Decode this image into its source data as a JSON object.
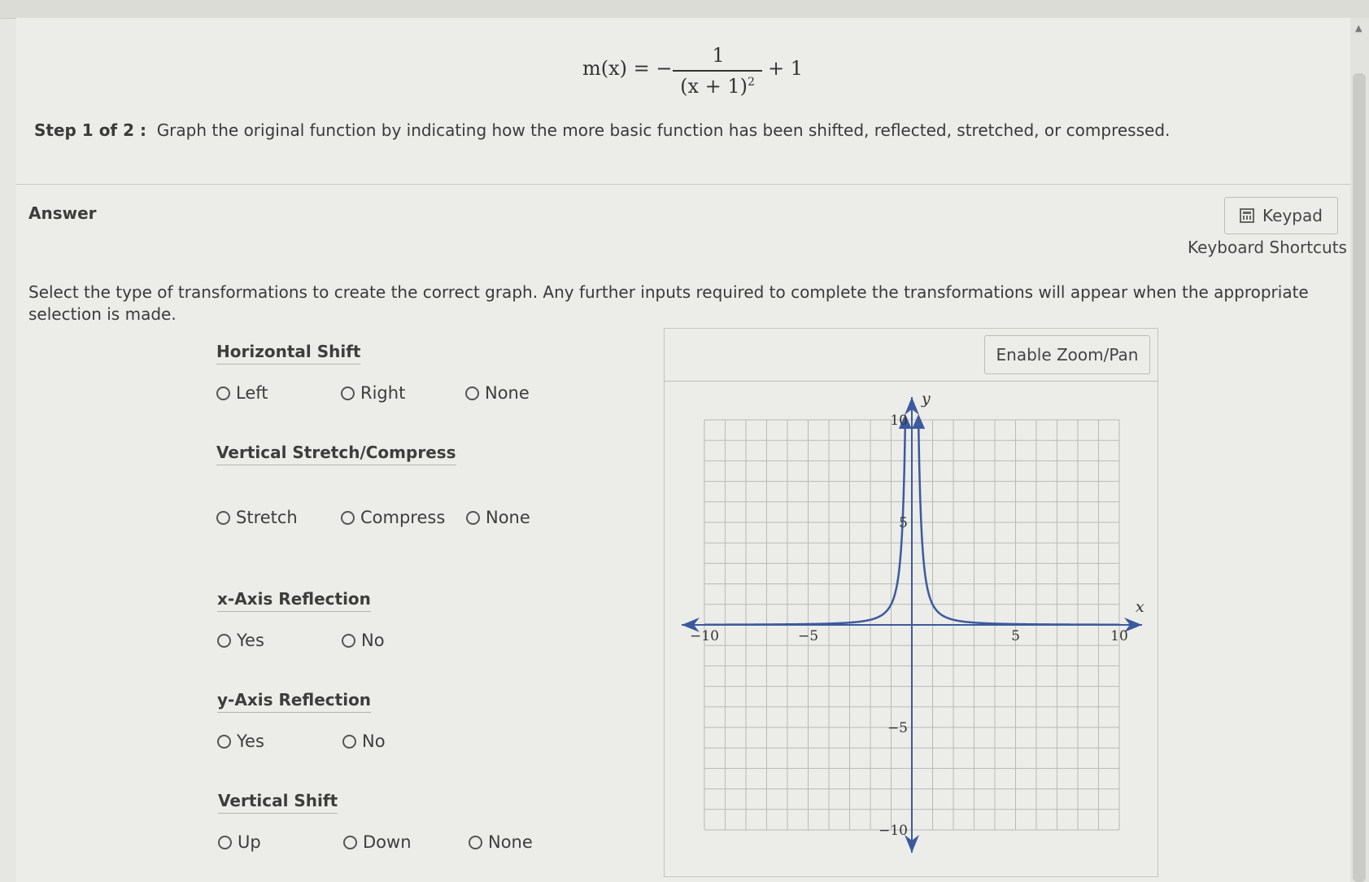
{
  "problem": {
    "formula": {
      "lhs": "m(x) = −",
      "numerator": "1",
      "denominator": "(x + 1)",
      "exponent": "2",
      "rhs": "+ 1"
    },
    "step_label": "Step 1 of 2 :",
    "step_text": "Graph the original function by indicating how the more basic function has been shifted, reflected, stretched, or compressed."
  },
  "answer": {
    "label": "Answer",
    "keypad_label": "Keypad",
    "keyboard_shortcuts": "Keyboard Shortcuts",
    "instructions": "Select the type of transformations to create the correct graph. Any further inputs required to complete the transformations will appear when the appropriate selection is made."
  },
  "sections": {
    "horizontal_shift": {
      "title": "Horizontal Shift",
      "options": [
        "Left",
        "Right",
        "None"
      ]
    },
    "vertical_stretch": {
      "title": "Vertical Stretch/Compress",
      "options": [
        "Stretch",
        "Compress",
        "None"
      ]
    },
    "x_reflection": {
      "title": "x-Axis Reflection",
      "options": [
        "Yes",
        "No"
      ]
    },
    "y_reflection": {
      "title": "y-Axis Reflection",
      "options": [
        "Yes",
        "No"
      ]
    },
    "vertical_shift": {
      "title": "Vertical Shift",
      "options": [
        "Up",
        "Down",
        "None"
      ]
    }
  },
  "graph": {
    "zoom_button": "Enable Zoom/Pan",
    "x_axis_label": "x",
    "y_axis_label": "y",
    "x_ticks": [
      {
        "value": -10,
        "label": "−10"
      },
      {
        "value": -5,
        "label": "−5"
      },
      {
        "value": 5,
        "label": "5"
      },
      {
        "value": 10,
        "label": "10"
      }
    ],
    "y_ticks": [
      {
        "value": 10,
        "label": "10"
      },
      {
        "value": 5,
        "label": "5"
      },
      {
        "value": -5,
        "label": "−5"
      },
      {
        "value": -10,
        "label": "−10"
      }
    ],
    "curve_color": "#3b5a9e",
    "axis_color": "#3b5a9e",
    "grid_color": "#b9b9b6"
  },
  "chart_data": {
    "type": "line",
    "function": "1/x^2",
    "xlim": [
      -10,
      10
    ],
    "ylim": [
      -10,
      10
    ],
    "grid": true,
    "series": [
      {
        "x": [
          -10,
          -5,
          -3,
          -2,
          -1,
          -0.5,
          -0.32
        ],
        "y": [
          0.01,
          0.04,
          0.11,
          0.25,
          1,
          4,
          9.8
        ]
      },
      {
        "x": [
          0.32,
          0.5,
          1,
          2,
          3,
          5,
          10
        ],
        "y": [
          9.8,
          4,
          1,
          0.25,
          0.11,
          0.04,
          0.01
        ]
      }
    ]
  }
}
